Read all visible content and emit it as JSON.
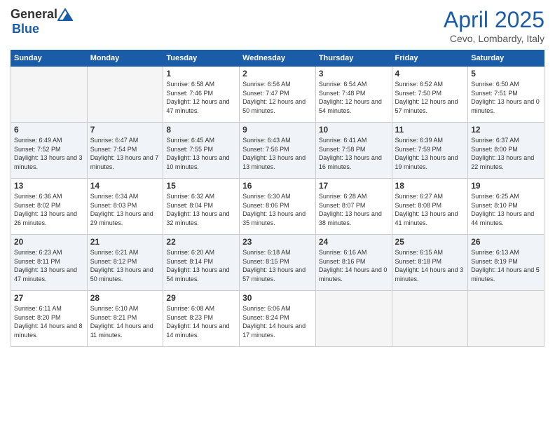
{
  "header": {
    "logo_general": "General",
    "logo_blue": "Blue",
    "month_title": "April 2025",
    "location": "Cevo, Lombardy, Italy"
  },
  "weekdays": [
    "Sunday",
    "Monday",
    "Tuesday",
    "Wednesday",
    "Thursday",
    "Friday",
    "Saturday"
  ],
  "weeks": [
    [
      {
        "day": "",
        "info": ""
      },
      {
        "day": "",
        "info": ""
      },
      {
        "day": "1",
        "info": "Sunrise: 6:58 AM\nSunset: 7:46 PM\nDaylight: 12 hours and 47 minutes."
      },
      {
        "day": "2",
        "info": "Sunrise: 6:56 AM\nSunset: 7:47 PM\nDaylight: 12 hours and 50 minutes."
      },
      {
        "day": "3",
        "info": "Sunrise: 6:54 AM\nSunset: 7:48 PM\nDaylight: 12 hours and 54 minutes."
      },
      {
        "day": "4",
        "info": "Sunrise: 6:52 AM\nSunset: 7:50 PM\nDaylight: 12 hours and 57 minutes."
      },
      {
        "day": "5",
        "info": "Sunrise: 6:50 AM\nSunset: 7:51 PM\nDaylight: 13 hours and 0 minutes."
      }
    ],
    [
      {
        "day": "6",
        "info": "Sunrise: 6:49 AM\nSunset: 7:52 PM\nDaylight: 13 hours and 3 minutes."
      },
      {
        "day": "7",
        "info": "Sunrise: 6:47 AM\nSunset: 7:54 PM\nDaylight: 13 hours and 7 minutes."
      },
      {
        "day": "8",
        "info": "Sunrise: 6:45 AM\nSunset: 7:55 PM\nDaylight: 13 hours and 10 minutes."
      },
      {
        "day": "9",
        "info": "Sunrise: 6:43 AM\nSunset: 7:56 PM\nDaylight: 13 hours and 13 minutes."
      },
      {
        "day": "10",
        "info": "Sunrise: 6:41 AM\nSunset: 7:58 PM\nDaylight: 13 hours and 16 minutes."
      },
      {
        "day": "11",
        "info": "Sunrise: 6:39 AM\nSunset: 7:59 PM\nDaylight: 13 hours and 19 minutes."
      },
      {
        "day": "12",
        "info": "Sunrise: 6:37 AM\nSunset: 8:00 PM\nDaylight: 13 hours and 22 minutes."
      }
    ],
    [
      {
        "day": "13",
        "info": "Sunrise: 6:36 AM\nSunset: 8:02 PM\nDaylight: 13 hours and 26 minutes."
      },
      {
        "day": "14",
        "info": "Sunrise: 6:34 AM\nSunset: 8:03 PM\nDaylight: 13 hours and 29 minutes."
      },
      {
        "day": "15",
        "info": "Sunrise: 6:32 AM\nSunset: 8:04 PM\nDaylight: 13 hours and 32 minutes."
      },
      {
        "day": "16",
        "info": "Sunrise: 6:30 AM\nSunset: 8:06 PM\nDaylight: 13 hours and 35 minutes."
      },
      {
        "day": "17",
        "info": "Sunrise: 6:28 AM\nSunset: 8:07 PM\nDaylight: 13 hours and 38 minutes."
      },
      {
        "day": "18",
        "info": "Sunrise: 6:27 AM\nSunset: 8:08 PM\nDaylight: 13 hours and 41 minutes."
      },
      {
        "day": "19",
        "info": "Sunrise: 6:25 AM\nSunset: 8:10 PM\nDaylight: 13 hours and 44 minutes."
      }
    ],
    [
      {
        "day": "20",
        "info": "Sunrise: 6:23 AM\nSunset: 8:11 PM\nDaylight: 13 hours and 47 minutes."
      },
      {
        "day": "21",
        "info": "Sunrise: 6:21 AM\nSunset: 8:12 PM\nDaylight: 13 hours and 50 minutes."
      },
      {
        "day": "22",
        "info": "Sunrise: 6:20 AM\nSunset: 8:14 PM\nDaylight: 13 hours and 54 minutes."
      },
      {
        "day": "23",
        "info": "Sunrise: 6:18 AM\nSunset: 8:15 PM\nDaylight: 13 hours and 57 minutes."
      },
      {
        "day": "24",
        "info": "Sunrise: 6:16 AM\nSunset: 8:16 PM\nDaylight: 14 hours and 0 minutes."
      },
      {
        "day": "25",
        "info": "Sunrise: 6:15 AM\nSunset: 8:18 PM\nDaylight: 14 hours and 3 minutes."
      },
      {
        "day": "26",
        "info": "Sunrise: 6:13 AM\nSunset: 8:19 PM\nDaylight: 14 hours and 5 minutes."
      }
    ],
    [
      {
        "day": "27",
        "info": "Sunrise: 6:11 AM\nSunset: 8:20 PM\nDaylight: 14 hours and 8 minutes."
      },
      {
        "day": "28",
        "info": "Sunrise: 6:10 AM\nSunset: 8:21 PM\nDaylight: 14 hours and 11 minutes."
      },
      {
        "day": "29",
        "info": "Sunrise: 6:08 AM\nSunset: 8:23 PM\nDaylight: 14 hours and 14 minutes."
      },
      {
        "day": "30",
        "info": "Sunrise: 6:06 AM\nSunset: 8:24 PM\nDaylight: 14 hours and 17 minutes."
      },
      {
        "day": "",
        "info": ""
      },
      {
        "day": "",
        "info": ""
      },
      {
        "day": "",
        "info": ""
      }
    ]
  ]
}
